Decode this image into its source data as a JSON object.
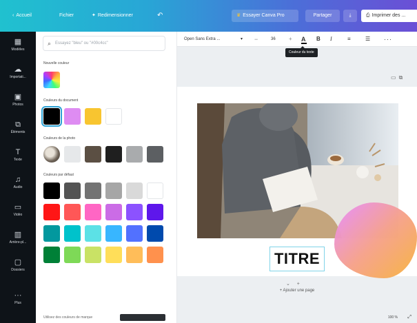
{
  "topbar": {
    "home_label": "Accueil",
    "file_label": "Fichier",
    "resize_label": "Redimensionner",
    "undo_icon": "undo-icon",
    "pro_label": "Essayer Canva Pro",
    "share_label": "Partager",
    "download_icon": "download-icon",
    "print_label": "Imprimer des ..."
  },
  "rail": [
    {
      "icon": "template-icon",
      "label": "Modèles"
    },
    {
      "icon": "upload-icon",
      "label": "Importati..."
    },
    {
      "icon": "photo-icon",
      "label": "Photos"
    },
    {
      "icon": "elements-icon",
      "label": "Éléments"
    },
    {
      "icon": "text-icon",
      "label": "Texte"
    },
    {
      "icon": "audio-icon",
      "label": "Audio"
    },
    {
      "icon": "video-icon",
      "label": "Vidéo"
    },
    {
      "icon": "background-icon",
      "label": "Arrière-pl..."
    },
    {
      "icon": "folder-icon",
      "label": "Dossiers"
    },
    {
      "icon": "more-icon",
      "label": "Plus"
    }
  ],
  "panel": {
    "search_placeholder": "Essayez \"bleu\" ou \"#00c4cc\"",
    "new_color_title": "Nouvelle couleur",
    "doc_colors_title": "Couleurs du document",
    "doc_colors": [
      "#000000",
      "#de8cf2",
      "#f8c530",
      "#ffffff"
    ],
    "photo_colors_title": "Couleurs de la photo",
    "photo_colors": [
      "#e6e8ea",
      "#5b4f43",
      "#1f1f1f",
      "#a9abad",
      "#5c5f62"
    ],
    "default_colors_title": "Couleurs par défaut",
    "default_colors": [
      [
        "#000000",
        "#545454",
        "#737373",
        "#a6a6a6",
        "#d9d9d9",
        "#ffffff"
      ],
      [
        "#ff1616",
        "#ff5757",
        "#ff66c4",
        "#cb6ce6",
        "#8c52ff",
        "#5e17eb"
      ],
      [
        "#03989e",
        "#00c2cb",
        "#5ce1e6",
        "#38b6ff",
        "#5271ff",
        "#004aad"
      ],
      [
        "#008037",
        "#7ed957",
        "#c9e265",
        "#ffde59",
        "#ffbd59",
        "#ff914d"
      ]
    ],
    "footer_text": "Utilisez des couleurs de marque"
  },
  "toolbar": {
    "font_name": "Open Sans Extra ...",
    "font_caret": "▾",
    "size_minus": "−",
    "font_size": "36",
    "size_plus": "+",
    "color_glyph": "A",
    "bold_glyph": "B",
    "italic_glyph": "I",
    "align_glyph": "≡",
    "list_glyph": "☰",
    "more_glyph": "···",
    "tooltip": "Couleur du texte"
  },
  "canvas": {
    "title_text": "TITRE",
    "page_ctrl": "⌄ +",
    "add_page_label": "+ Ajouter une page"
  },
  "footer": {
    "zoom": "100 %",
    "fullscreen_icon": "expand-icon"
  }
}
